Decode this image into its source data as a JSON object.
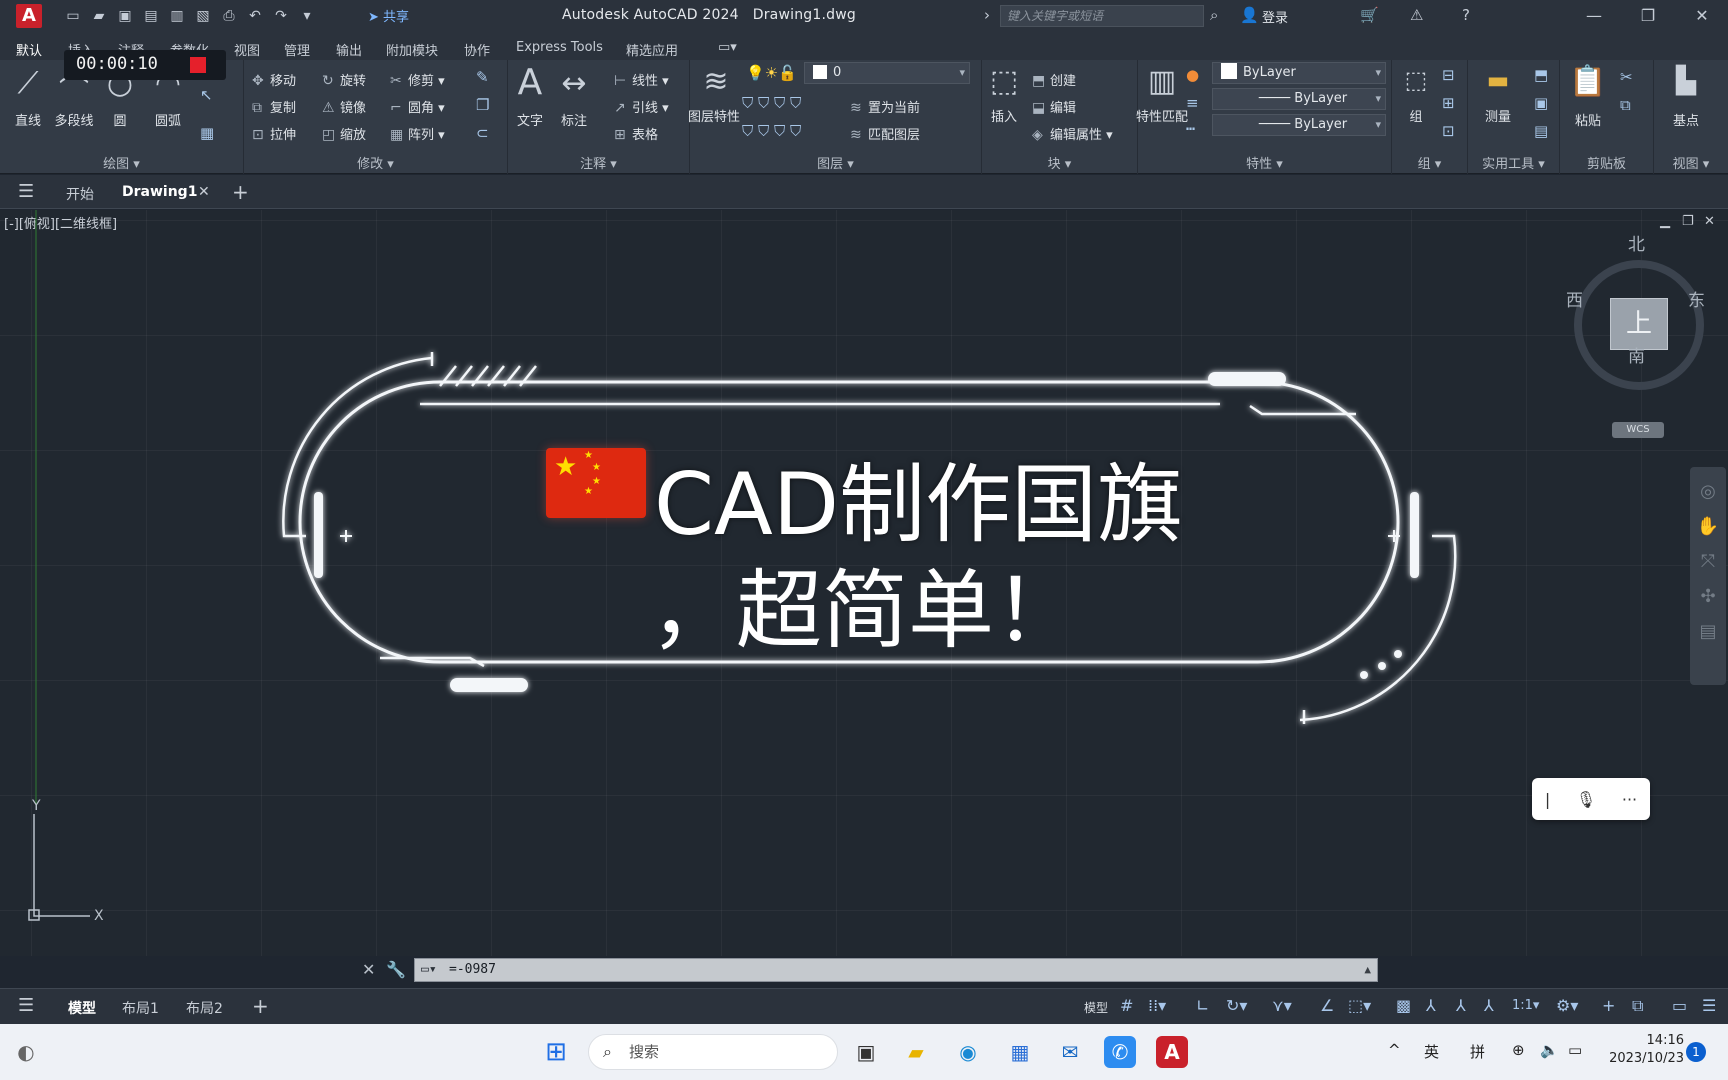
{
  "titlebar": {
    "app_title": "Autodesk AutoCAD 2024",
    "doc_title": "Drawing1.dwg",
    "share_label": "共享",
    "search_placeholder": "键入关键字或短语",
    "login_label": "登录"
  },
  "ribbon_tabs": [
    "默认",
    "插入",
    "注释",
    "参数化",
    "视图",
    "管理",
    "输出",
    "附加模块",
    "协作",
    "Express Tools",
    "精选应用"
  ],
  "timer": "00:00:10",
  "draw_panel": {
    "title": "绘图",
    "line": "直线",
    "polyline": "多段线",
    "circle": "圆",
    "arc": "圆弧"
  },
  "modify_panel": {
    "title": "修改",
    "move": "移动",
    "rotate": "旋转",
    "trim": "修剪",
    "copy": "复制",
    "mirror": "镜像",
    "fillet": "圆角",
    "stretch": "拉伸",
    "scale": "缩放",
    "array": "阵列"
  },
  "annotation_panel": {
    "title": "注释",
    "text": "文字",
    "dimension": "标注",
    "linear": "线性",
    "leader": "引线",
    "table": "表格"
  },
  "layers_panel": {
    "title": "图层",
    "layer_props": "图层特性",
    "current_layer": "0",
    "make_current": "置为当前",
    "match_layer": "匹配图层"
  },
  "block_panel": {
    "title": "块",
    "insert": "插入",
    "create": "创建",
    "edit": "编辑",
    "edit_attr": "编辑属性"
  },
  "properties_panel": {
    "title": "特性",
    "match": "特性匹配",
    "color": "ByLayer",
    "linetype": "ByLayer",
    "lineweight": "ByLayer"
  },
  "group_panel": {
    "title": "组",
    "group": "组"
  },
  "utilities_panel": {
    "title": "实用工具",
    "measure": "测量"
  },
  "clipboard_panel": {
    "title": "剪贴板",
    "paste": "粘贴"
  },
  "view_panel": {
    "title": "视图",
    "base": "基点"
  },
  "file_tabs": {
    "start": "开始",
    "drawing": "Drawing1"
  },
  "viewport": {
    "label": "[-][俯视][二维线框]",
    "viewcube_top": "上",
    "compass_n": "北",
    "compass_s": "南",
    "compass_e": "东",
    "compass_w": "西",
    "wcs": "WCS",
    "ucs_x": "X",
    "ucs_y": "Y"
  },
  "banner": {
    "line1": "CAD制作国旗",
    "line2": "，超简单！"
  },
  "command_line": {
    "value": "=-0987"
  },
  "layout_tabs": [
    "模型",
    "布局1",
    "布局2"
  ],
  "status": {
    "model_label": "模型",
    "scale": "1:1"
  },
  "taskbar": {
    "search_placeholder": "搜索",
    "ime_lang": "英",
    "ime_mode": "拼",
    "time": "14:16",
    "date": "2023/10/23",
    "notifications": "1"
  },
  "colors": {
    "accent_red": "#c9212b",
    "flag_red": "#de2910",
    "flag_star": "#ffde00",
    "canvas_bg": "#212830"
  }
}
